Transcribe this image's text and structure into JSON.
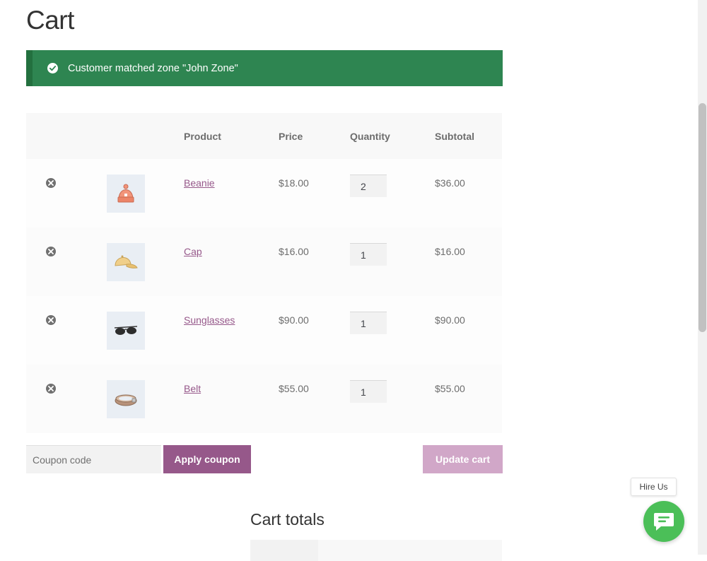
{
  "page": {
    "title": "Cart"
  },
  "notice": {
    "message": "Customer matched zone \"John Zone\"",
    "color": "#2e8551"
  },
  "table": {
    "headers": {
      "product": "Product",
      "price": "Price",
      "quantity": "Quantity",
      "subtotal": "Subtotal"
    },
    "rows": [
      {
        "name": "Beanie",
        "price": "$18.00",
        "quantity": "2",
        "subtotal": "$36.00",
        "icon": "beanie-icon"
      },
      {
        "name": "Cap",
        "price": "$16.00",
        "quantity": "1",
        "subtotal": "$16.00",
        "icon": "cap-icon"
      },
      {
        "name": "Sunglasses",
        "price": "$90.00",
        "quantity": "1",
        "subtotal": "$90.00",
        "icon": "sunglasses-icon"
      },
      {
        "name": "Belt",
        "price": "$55.00",
        "quantity": "1",
        "subtotal": "$55.00",
        "icon": "belt-icon"
      }
    ]
  },
  "actions": {
    "coupon_placeholder": "Coupon code",
    "apply_label": "Apply coupon",
    "update_label": "Update cart",
    "accent": "#96588a"
  },
  "totals": {
    "title": "Cart totals"
  },
  "widget": {
    "tooltip": "Hire Us",
    "color": "#4bbf58"
  }
}
